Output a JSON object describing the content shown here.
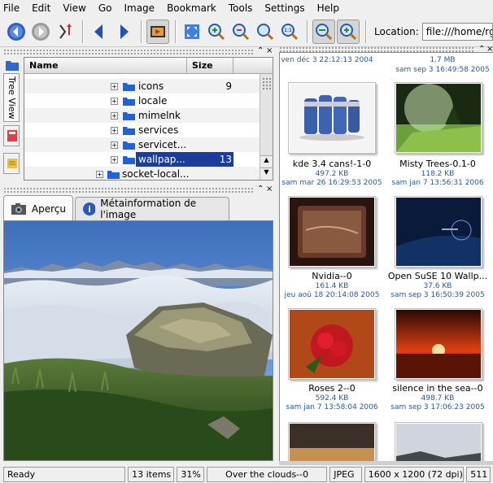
{
  "menu": [
    "File",
    "Edit",
    "View",
    "Go",
    "Image",
    "Bookmark",
    "Tools",
    "Settings",
    "Help"
  ],
  "location": {
    "label": "Location:",
    "value": "file:///home/rgr"
  },
  "side_tab": {
    "label": "Tree View"
  },
  "tree": {
    "columns": [
      "Name",
      "Size"
    ],
    "rows": [
      {
        "label": "icons",
        "size": "9"
      },
      {
        "label": "locale",
        "size": ""
      },
      {
        "label": "mimelnk",
        "size": ""
      },
      {
        "label": "services",
        "size": ""
      },
      {
        "label": "servicet...",
        "size": ""
      },
      {
        "label": "wallpap...",
        "size": "13"
      },
      {
        "label": "socket-local...",
        "size": ""
      }
    ]
  },
  "tabs": {
    "preview": "Aperçu",
    "meta": "Métainformation de l'image"
  },
  "thumbs_top": {
    "date_left": "ven déc 3 22:12:13 2004",
    "size_right": "1.7 MB",
    "date_right": "sam sep 3 16:49:58 2005"
  },
  "thumbs": [
    {
      "name": "kde 3.4 cans!-1-0",
      "size": "497.2 KB",
      "date": "sam mar 26 16:29:53 2005"
    },
    {
      "name": "Misty Trees-0.1-0",
      "size": "118.2 KB",
      "date": "sam jan 7 13:56:31 2006"
    },
    {
      "name": "Nvidia--0",
      "size": "161.4 KB",
      "date": "jeu aoû 18 20:14:08 2005"
    },
    {
      "name": "Open SuSE 10 Wallp...",
      "size": "37.6 KB",
      "date": "sam sep 3 16:50:39 2005"
    },
    {
      "name": "Roses 2--0",
      "size": "592.4 KB",
      "date": "sam jan 7 13:58:04 2006"
    },
    {
      "name": "silence in the sea--0",
      "size": "498.7 KB",
      "date": "sam sep 3 17:06:23 2005"
    }
  ],
  "status": {
    "ready": "Ready",
    "items": "13 items",
    "zoom": "31%",
    "file": "Over the clouds--0",
    "format": "JPEG",
    "dims": "1600 x 1200 (72 dpi)",
    "extra": "511"
  },
  "colors": {
    "accent": "#1c3c9c",
    "link_blue": "#2a5aa0"
  }
}
